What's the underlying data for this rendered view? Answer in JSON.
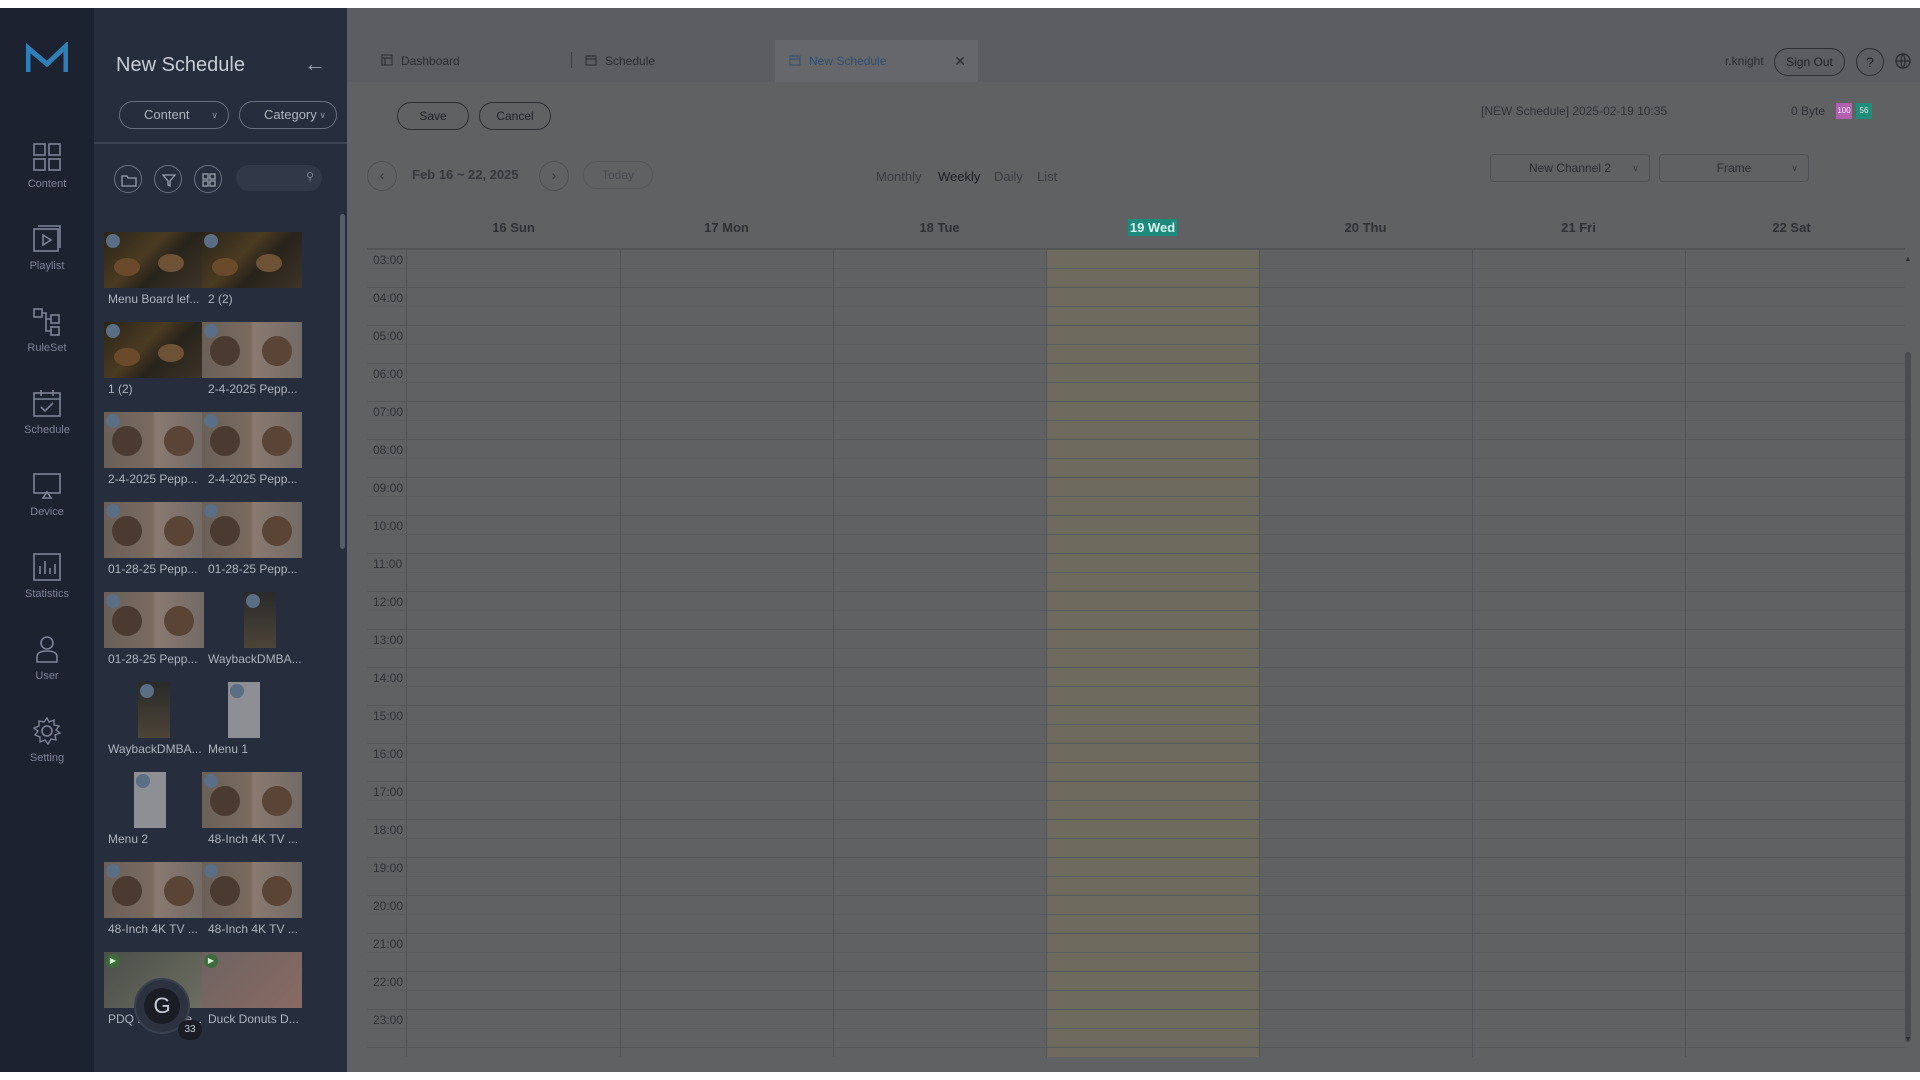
{
  "nav": {
    "items": [
      {
        "label": "Content",
        "icon": "content-grid-icon"
      },
      {
        "label": "Playlist",
        "icon": "playlist-icon"
      },
      {
        "label": "RuleSet",
        "icon": "ruleset-icon"
      },
      {
        "label": "Schedule",
        "icon": "schedule-icon"
      },
      {
        "label": "Device",
        "icon": "device-icon"
      },
      {
        "label": "Statistics",
        "icon": "statistics-icon"
      },
      {
        "label": "User",
        "icon": "user-icon"
      },
      {
        "label": "Setting",
        "icon": "gear-icon"
      }
    ]
  },
  "library": {
    "title": "New Schedule",
    "content_filter": "Content",
    "category_filter": "Category",
    "search_placeholder": "",
    "items": [
      {
        "caption": "Menu Board lef...",
        "kind": "dark"
      },
      {
        "caption": "2 (2)",
        "kind": "dark"
      },
      {
        "caption": "1 (2)",
        "kind": "dark"
      },
      {
        "caption": "2-4-2025 Pepp...",
        "kind": "bowl"
      },
      {
        "caption": "2-4-2025 Pepp...",
        "kind": "bowl"
      },
      {
        "caption": "2-4-2025 Pepp...",
        "kind": "bowl"
      },
      {
        "caption": "01-28-25 Pepp...",
        "kind": "bowl"
      },
      {
        "caption": "01-28-25 Pepp...",
        "kind": "bowl"
      },
      {
        "caption": "01-28-25 Pepp...",
        "kind": "bowl"
      },
      {
        "caption": "WaybackDMBA...",
        "kind": "tall"
      },
      {
        "caption": "WaybackDMBA...",
        "kind": "tall"
      },
      {
        "caption": "Menu 1",
        "kind": "menu"
      },
      {
        "caption": "Menu 2",
        "kind": "menu"
      },
      {
        "caption": "48-Inch 4K TV ...",
        "kind": "bowl"
      },
      {
        "caption": "48-Inch 4K TV ...",
        "kind": "bowl"
      },
      {
        "caption": "48-Inch 4K TV ...",
        "kind": "bowl"
      },
      {
        "caption": "PDQ DMB Scre...",
        "kind": "video"
      },
      {
        "caption": "Duck Donuts D...",
        "kind": "video2"
      }
    ]
  },
  "tabs": [
    {
      "label": "Dashboard",
      "icon": "dashboard-icon"
    },
    {
      "label": "Schedule",
      "icon": "schedule-tab-icon"
    },
    {
      "label": "New Schedule",
      "icon": "new-schedule-tab-icon",
      "active": true
    }
  ],
  "header": {
    "user": "r.knight",
    "sign_out": "Sign Out",
    "help": "?"
  },
  "toolbar": {
    "save": "Save",
    "cancel": "Cancel",
    "info": "[NEW Schedule] 2025-02-19 10:35",
    "size": "0 Byte",
    "chip1": "100",
    "chip2": "56",
    "chip1_color": "#b35fb0",
    "chip2_color": "#1f8c7c"
  },
  "calendar": {
    "range": "Feb 16 ~ 22, 2025",
    "today_button": "Today",
    "views": [
      "Monthly",
      "Weekly",
      "Daily",
      "List"
    ],
    "selected_view": "Weekly",
    "channel": "New Channel 2",
    "frame": "Frame",
    "days": [
      "16 Sun",
      "17 Mon",
      "18 Tue",
      "19 Wed",
      "20 Thu",
      "21 Fri",
      "22 Sat"
    ],
    "today_day": "19 Wed",
    "hours": [
      "03:00",
      "04:00",
      "05:00",
      "06:00",
      "07:00",
      "08:00",
      "09:00",
      "10:00",
      "11:00",
      "12:00",
      "13:00",
      "14:00",
      "15:00",
      "16:00",
      "17:00",
      "18:00",
      "19:00",
      "20:00",
      "21:00",
      "22:00",
      "23:00"
    ]
  },
  "avatar": {
    "letter": "G",
    "count": "33"
  },
  "colors": {
    "rail": "#1d2230",
    "panel": "#262d3c",
    "accent": "#1f8c7c"
  }
}
